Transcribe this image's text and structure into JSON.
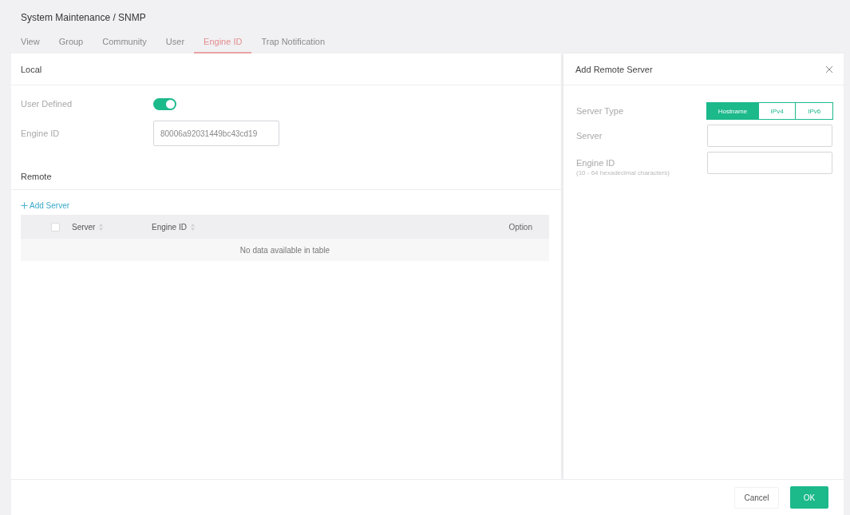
{
  "breadcrumb": "System Maintenance / SNMP",
  "tabs": [
    {
      "label": "View",
      "selected": false
    },
    {
      "label": "Group",
      "selected": false
    },
    {
      "label": "Community",
      "selected": false
    },
    {
      "label": "User",
      "selected": false
    },
    {
      "label": "Engine ID",
      "selected": true
    },
    {
      "label": "Trap Notification",
      "selected": false
    }
  ],
  "local": {
    "title": "Local",
    "fields": [
      {
        "kind": "toggle",
        "label": "User Defined",
        "on": true
      },
      {
        "kind": "input",
        "label": "Engine ID",
        "value": "80006a92031449bc43cd19"
      }
    ]
  },
  "remote": {
    "title": "Remote",
    "add_button": "Add Server",
    "table": {
      "select_all": {
        "checked": false
      },
      "columns": [
        {
          "label": "Server",
          "sortable": true
        },
        {
          "label": "Engine ID",
          "sortable": true
        },
        {
          "label": "Option",
          "sortable": false
        }
      ],
      "empty_message": "No data available in table"
    }
  },
  "drawer": {
    "title": "Add Remote Server",
    "fields": [
      {
        "kind": "segmented",
        "label": "Server Type",
        "options": [
          {
            "label": "Hostname",
            "selected": true
          },
          {
            "label": "IPv4",
            "selected": false
          },
          {
            "label": "IPv6",
            "selected": false
          }
        ]
      },
      {
        "kind": "input",
        "label": "Server"
      },
      {
        "kind": "input",
        "label": "Engine ID",
        "hint": "(10 - 64 hexadecimal characters)"
      }
    ]
  },
  "footer": {
    "buttons": [
      {
        "label": "Cancel",
        "kind": "secondary"
      },
      {
        "label": "OK",
        "kind": "primary"
      }
    ]
  }
}
